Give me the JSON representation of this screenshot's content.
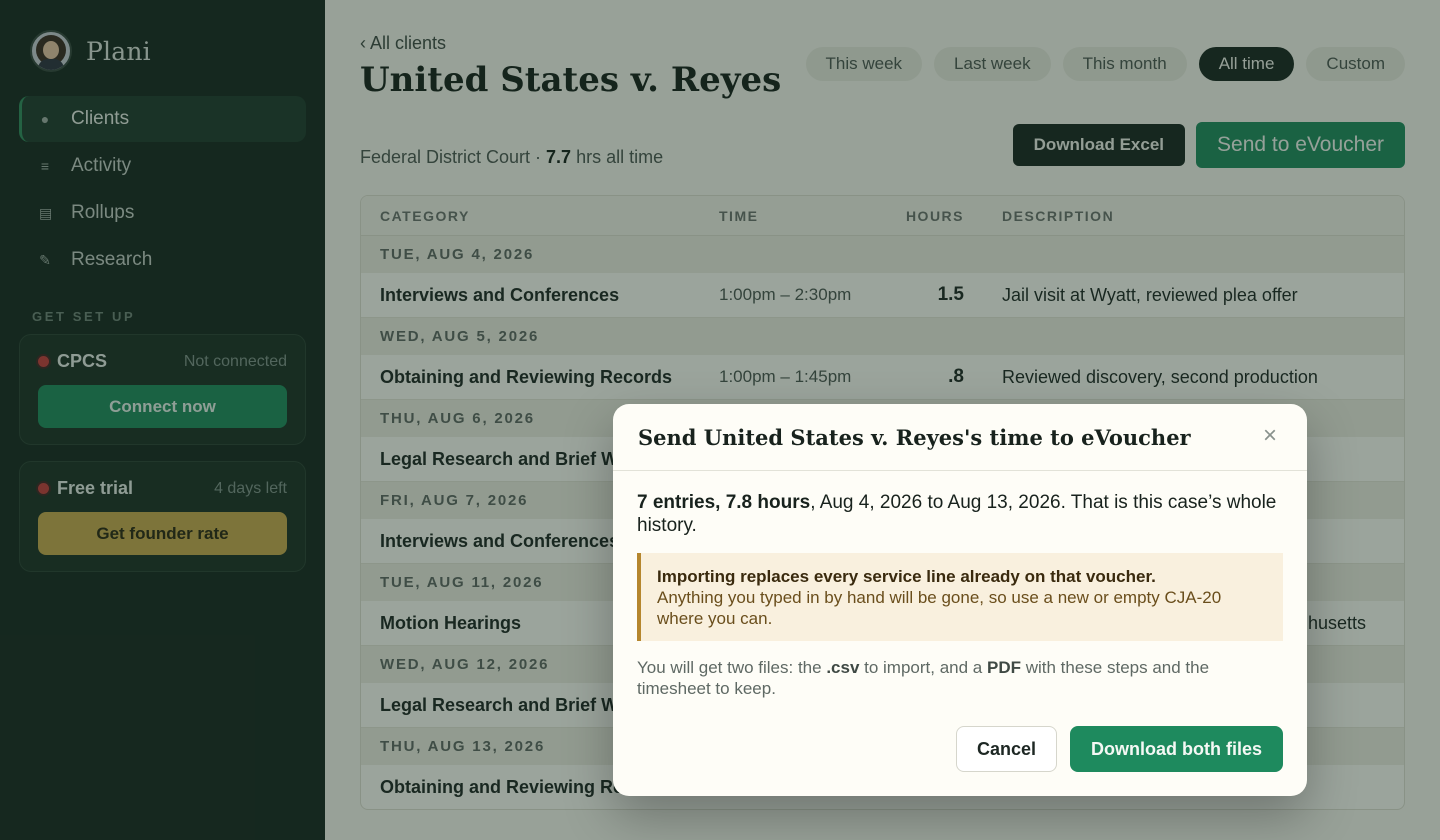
{
  "brand": {
    "name": "Plani"
  },
  "nav": [
    {
      "label": "Clients",
      "icon": "●",
      "active": true
    },
    {
      "label": "Activity",
      "icon": "≡",
      "active": false
    },
    {
      "label": "Rollups",
      "icon": "▤",
      "active": false
    },
    {
      "label": "Research",
      "icon": "✎",
      "active": false
    }
  ],
  "setup": {
    "label": "GET SET UP",
    "cpcs": {
      "title": "CPCS",
      "status": "Not connected",
      "button": "Connect now"
    },
    "trial": {
      "title": "Free trial",
      "status": "4 days left",
      "button": "Get founder rate"
    }
  },
  "header": {
    "back": "‹ All clients",
    "title": "United States v. Reyes",
    "court": "Federal District Court · ",
    "hours": "7.7",
    "hours_suffix": " hrs all time"
  },
  "ranges": [
    {
      "label": "This week",
      "active": false
    },
    {
      "label": "Last week",
      "active": false
    },
    {
      "label": "This month",
      "active": false
    },
    {
      "label": "All time",
      "active": true
    },
    {
      "label": "Custom",
      "active": false
    }
  ],
  "actions": {
    "excel": "Download Excel",
    "voucher": "Send to eVoucher"
  },
  "table": {
    "columns": {
      "category": "CATEGORY",
      "time": "TIME",
      "hours": "HOURS",
      "description": "DESCRIPTION"
    },
    "groups": [
      {
        "date": "TUE, AUG 4, 2026",
        "category": "Interviews and Conferences",
        "time": "1:00pm – 2:30pm",
        "hours": "1.5",
        "description": "Jail visit at Wyatt, reviewed plea offer"
      },
      {
        "date": "WED, AUG 5, 2026",
        "category": "Obtaining and Reviewing Records",
        "time": "1:00pm – 1:45pm",
        "hours": ".8",
        "description": "Reviewed discovery, second production"
      },
      {
        "date": "THU, AUG 6, 2026",
        "category": "Legal Research and Brief W",
        "time": "",
        "hours": "",
        "description": ""
      },
      {
        "date": "FRI, AUG 7, 2026",
        "category": "Interviews and Conferences",
        "time": "",
        "hours": "",
        "description": ""
      },
      {
        "date": "TUE, AUG 11, 2026",
        "category": "Motion Hearings",
        "time": "",
        "hours": "",
        "description": "husetts"
      },
      {
        "date": "WED, AUG 12, 2026",
        "category": "Legal Research and Brief W",
        "time": "",
        "hours": "",
        "description": ""
      },
      {
        "date": "THU, AUG 13, 2026",
        "category": "Obtaining and Reviewing Re",
        "time": "",
        "hours": "",
        "description": ""
      }
    ]
  },
  "modal": {
    "title": "Send United States v. Reyes's time to eVoucher",
    "close": "×",
    "summary_bold": "7 entries, 7.8 hours",
    "summary_rest": ", Aug 4, 2026 to Aug 13, 2026. That is this case’s whole history.",
    "warning_title": "Importing replaces every service line already on that voucher.",
    "warning_body": "Anything you typed in by hand will be gone, so use a new or empty CJA-20 where you can.",
    "files_1": "You will get two files: the ",
    "files_csv": ".csv",
    "files_2": " to import, and a ",
    "files_pdf": "PDF",
    "files_3": " with these steps and the timesheet to keep.",
    "cancel": "Cancel",
    "download": "Download both files"
  }
}
